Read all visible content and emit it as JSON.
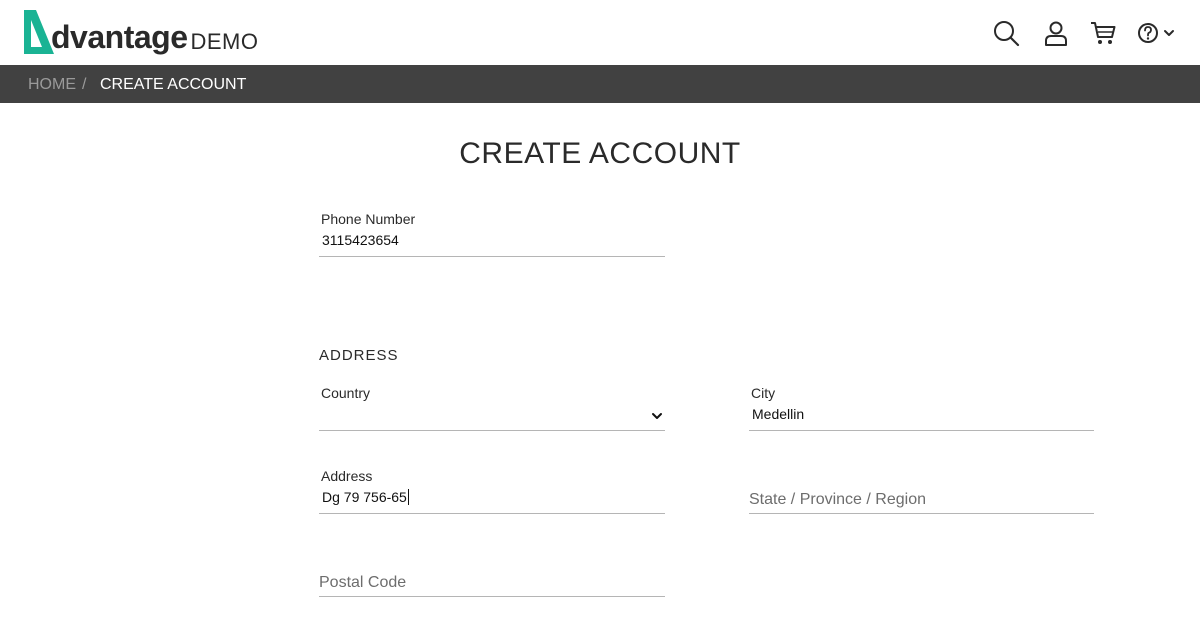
{
  "header": {
    "logo_word": "dvantage",
    "logo_suffix": "DEMO",
    "brand_color": "#1ab394",
    "icons": [
      "search-icon",
      "user-icon",
      "cart-icon",
      "help-icon",
      "chevron-down-icon"
    ]
  },
  "breadcrumb": {
    "home": "HOME",
    "separator": "/",
    "current": "CREATE ACCOUNT"
  },
  "page": {
    "title": "CREATE ACCOUNT"
  },
  "form": {
    "phone": {
      "label": "Phone Number",
      "value": "3115423654"
    },
    "address_section": "ADDRESS",
    "country": {
      "label": "Country",
      "value": ""
    },
    "city": {
      "label": "City",
      "value": "Medellin"
    },
    "address": {
      "label": "Address",
      "value": "Dg 79 756-65"
    },
    "state": {
      "placeholder": "State / Province / Region",
      "value": ""
    },
    "postal": {
      "placeholder": "Postal Code",
      "value": ""
    }
  }
}
